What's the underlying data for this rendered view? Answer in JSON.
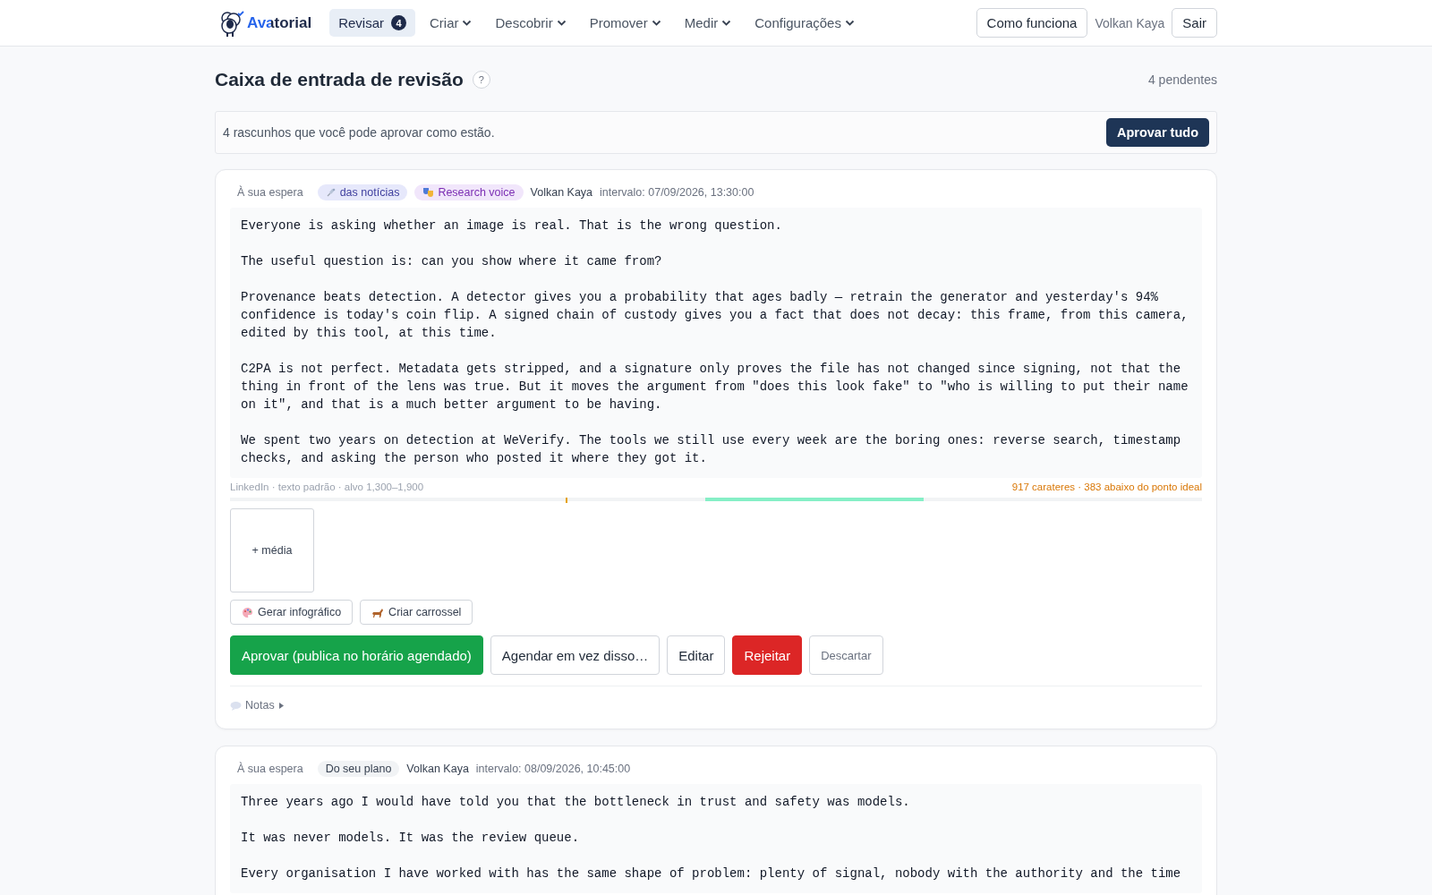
{
  "nav": {
    "logo": "Avatorial",
    "items": [
      {
        "label": "Revisar",
        "badge": "4",
        "selected": true,
        "dropdown": false
      },
      {
        "label": "Criar",
        "selected": false,
        "dropdown": true
      },
      {
        "label": "Descobrir",
        "selected": false,
        "dropdown": true
      },
      {
        "label": "Promover",
        "selected": false,
        "dropdown": true
      },
      {
        "label": "Medir",
        "selected": false,
        "dropdown": true
      },
      {
        "label": "Configurações",
        "selected": false,
        "dropdown": true
      }
    ],
    "help_button": "Como funciona",
    "user": "Volkan Kaya",
    "logout_button": "Sair"
  },
  "header": {
    "title": "Caixa de entrada de revisão",
    "help": "?",
    "pending": "4 pendentes"
  },
  "banner": {
    "text": "4 rascunhos que você pode aprovar como estão.",
    "button": "Aprovar tudo"
  },
  "drafts": [
    {
      "status": "À sua espera",
      "tags": [
        {
          "label": "das notícias",
          "kind": "source",
          "color": "#3f3f9e"
        },
        {
          "label": "Research voice",
          "kind": "voice",
          "color": "#7c2fb4"
        }
      ],
      "author": "Volkan Kaya",
      "slot": "intervalo: 07/09/2026, 13:30:00",
      "body": "Everyone is asking whether an image is real. That is the wrong question.\n\nThe useful question is: can you show where it came from?\n\nProvenance beats detection. A detector gives you a probability that ages badly — retrain the generator and yesterday's 94%\nconfidence is today's coin flip. A signed chain of custody gives you a fact that does not decay: this frame, from this camera,\nedited by this tool, at this time.\n\nC2PA is not perfect. Metadata gets stripped, and a signature only proves the file has not changed since signing, not that the\nthing in front of the lens was true. But it moves the argument from \"does this look fake\" to \"who is willing to put their name\non it\", and that is a much better argument to be having.\n\nWe spent two years on detection at WeVerify. The tools we still use every week are the boring ones: reverse search, timestamp\nchecks, and asking the person who posted it where they got it.",
      "meter": {
        "info": "LinkedIn · texto padrão · alvo 1,300–1,900",
        "reading": "917 carateres · 383 abaixo do ponto ideal",
        "level": 0.345
      },
      "media_button": "+ média",
      "tools": [
        {
          "label": "Gerar infográfico",
          "kind": "infographic"
        },
        {
          "label": "Criar carrossel",
          "kind": "carousel"
        }
      ],
      "actions": [
        {
          "label": "Aprovar (publica no horário agendado)",
          "kind": "approve"
        },
        {
          "label": "Agendar em vez disso…",
          "kind": "plain"
        },
        {
          "label": "Editar",
          "kind": "plain"
        },
        {
          "label": "Rejeitar",
          "kind": "reject"
        },
        {
          "label": "Descartar",
          "kind": "muted"
        }
      ],
      "notes": {
        "label": "Notas",
        "expanded": false
      }
    },
    {
      "status": "À sua espera",
      "tags": [
        {
          "label": "Do seu plano",
          "kind": "plan",
          "color": "#374151"
        }
      ],
      "author": "Volkan Kaya",
      "slot": "intervalo: 08/09/2026, 10:45:00",
      "body": "Three years ago I would have told you that the bottleneck in trust and safety was models.\n\nIt was never models. It was the review queue.\n\nEvery organisation I have worked with has the same shape of problem: plenty of signal, nobody with the authority and the time"
    }
  ]
}
